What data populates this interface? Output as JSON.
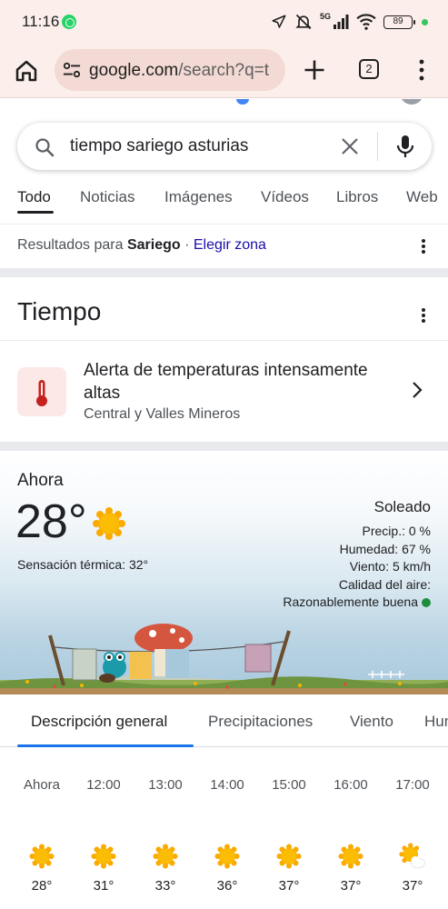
{
  "status_bar": {
    "time": "11:16",
    "network": "5G",
    "battery": "89"
  },
  "browser": {
    "url_host": "google.com",
    "url_path": "/search?q=t",
    "tab_count": "2"
  },
  "search": {
    "query": "tiempo sariego asturias"
  },
  "tabs": [
    "Todo",
    "Noticias",
    "Imágenes",
    "Vídeos",
    "Libros",
    "Web"
  ],
  "location_notice": {
    "prefix": "Resultados para ",
    "place": "Sariego",
    "separator": " · ",
    "link": "Elegir zona"
  },
  "weather": {
    "title": "Tiempo",
    "alert": {
      "title": "Alerta de temperaturas intensamente altas",
      "region": "Central y Valles Mineros"
    },
    "now": {
      "label": "Ahora",
      "temp": "28°",
      "feels_like": "Sensación térmica: 32°",
      "condition": "Soleado",
      "precip": "Precip.: 0 %",
      "humidity": "Humedad: 67 %",
      "wind": "Viento: 5 km/h",
      "air_quality_label": "Calidad del aire:",
      "air_quality_value": "Razonablemente buena"
    },
    "forecast_tabs": [
      "Descripción general",
      "Precipitaciones",
      "Viento",
      "Hum"
    ],
    "hourly": [
      {
        "time": "Ahora",
        "temp": "28°",
        "icon": "sun-icon"
      },
      {
        "time": "12:00",
        "temp": "31°",
        "icon": "sun-icon"
      },
      {
        "time": "13:00",
        "temp": "33°",
        "icon": "sun-icon"
      },
      {
        "time": "14:00",
        "temp": "36°",
        "icon": "sun-icon"
      },
      {
        "time": "15:00",
        "temp": "37°",
        "icon": "sun-icon"
      },
      {
        "time": "16:00",
        "temp": "37°",
        "icon": "sun-icon"
      },
      {
        "time": "17:00",
        "temp": "37°",
        "icon": "partly-cloudy-icon"
      }
    ]
  },
  "colors": {
    "browser_bar": "#fcefeb",
    "link": "#1a0dab",
    "accent": "#1a73e8",
    "sun": "#f9ab00",
    "alert_red": "#c5221f",
    "air_good": "#1e8e3e"
  }
}
